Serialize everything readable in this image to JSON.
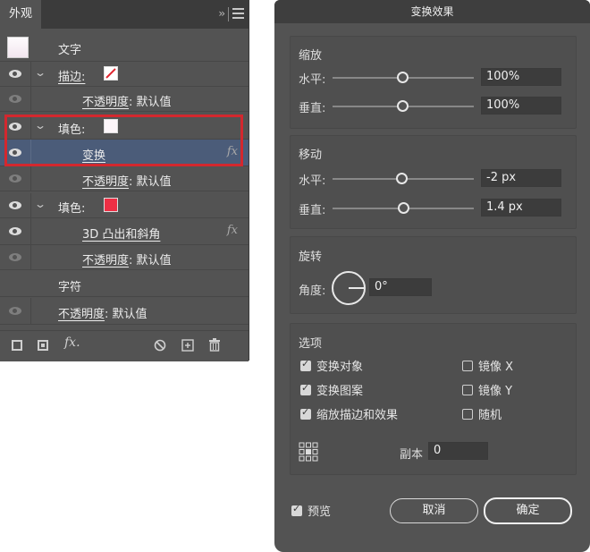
{
  "appearance": {
    "tab_label": "外观",
    "collapse_glyph": "››",
    "rows": {
      "text": "文字",
      "stroke": "描边:",
      "stroke_opacity_label": "不透明度",
      "stroke_opacity_value": ": 默认值",
      "fill1": "填色:",
      "transform": "变换",
      "fill1_opacity_label": "不透明度",
      "fill1_opacity_value": ": 默认值",
      "fill2": "填色:",
      "bevel": "3D 凸出和斜角",
      "fill2_opacity_label": "不透明度",
      "fill2_opacity_value": ": 默认值",
      "character": "字符",
      "opacity_label": "不透明度",
      "opacity_value": ": 默认值"
    },
    "fx_glyph": "fx",
    "bottom_fx_glyph": "fx.",
    "colors": {
      "fill_white": "#fdf6fa",
      "fill_red": "#ee2f45",
      "selection": "#4b5c79",
      "highlight_box": "#d3282e"
    }
  },
  "dialog": {
    "title": "变换效果",
    "scale": {
      "title": "缩放",
      "h_label": "水平:",
      "h_value": "100%",
      "v_label": "垂直:",
      "v_value": "100%"
    },
    "move": {
      "title": "移动",
      "h_label": "水平:",
      "h_value": "-2 px",
      "v_label": "垂直:",
      "v_value": "1.4 px"
    },
    "rotate": {
      "title": "旋转",
      "angle_label": "角度:",
      "angle_value": "0°"
    },
    "options": {
      "title": "选项",
      "transform_objects": "变换对象",
      "transform_patterns": "变换图案",
      "scale_strokes": "缩放描边和效果",
      "reflect_x": "镜像 X",
      "reflect_y": "镜像 Y",
      "random": "随机",
      "copies_label": "副本",
      "copies_value": "0"
    },
    "preview_label": "预览",
    "cancel_label": "取消",
    "ok_label": "确定"
  }
}
